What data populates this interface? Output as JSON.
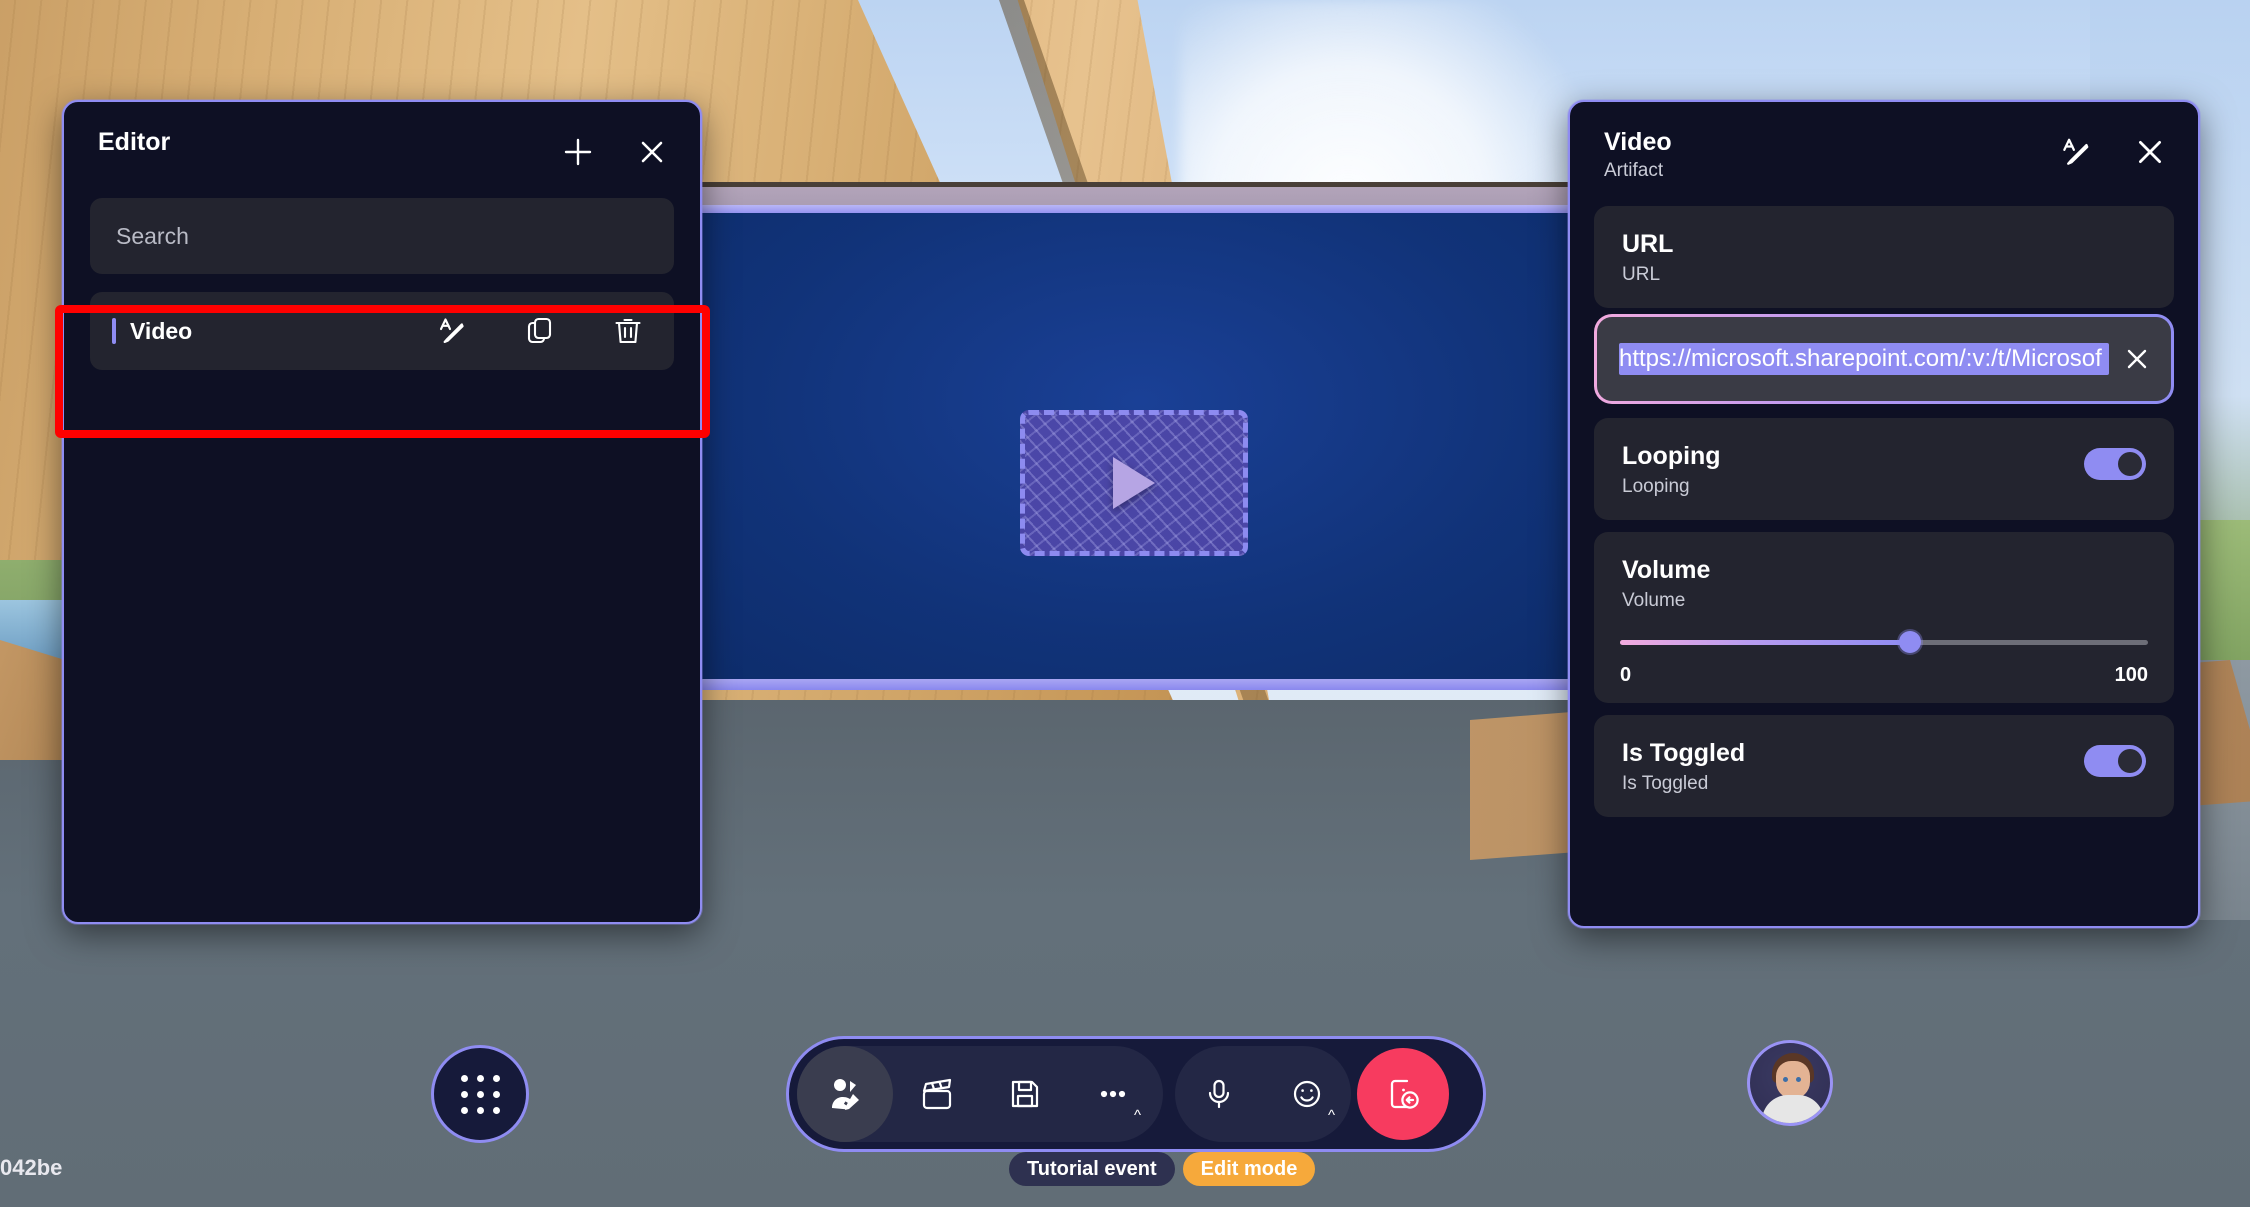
{
  "editor_panel": {
    "title": "Editor",
    "add_icon": "plus-icon",
    "close_icon": "close-icon",
    "search": {
      "placeholder": "Search"
    },
    "items": [
      {
        "label": "Video",
        "rename_icon": "rename-icon",
        "duplicate_icon": "duplicate-icon",
        "delete_icon": "trash-icon"
      }
    ]
  },
  "properties_panel": {
    "title": "Video",
    "subtitle": "Artifact",
    "rename_icon": "rename-icon",
    "close_icon": "close-icon",
    "url_property": {
      "title": "URL",
      "subtitle": "URL",
      "value": "https://microsoft.sharepoint.com/:v:/t/Microsof",
      "selected": true,
      "clear_icon": "close-icon"
    },
    "looping_property": {
      "title": "Looping",
      "subtitle": "Looping",
      "toggle_on": true
    },
    "volume_property": {
      "title": "Volume",
      "subtitle": "Volume",
      "min_label": "0",
      "max_label": "100",
      "value_percent": 55
    },
    "is_toggled_property": {
      "title": "Is Toggled",
      "subtitle": "Is Toggled",
      "toggle_on": true
    }
  },
  "hud": {
    "apps_button_icon": "app-grid-icon",
    "toolbar": [
      {
        "icon": "build-mode-icon",
        "active": true
      },
      {
        "icon": "clapperboard-icon",
        "active": false
      },
      {
        "icon": "save-icon",
        "active": false
      },
      {
        "icon": "more-options-icon",
        "active": false,
        "chevron": "^"
      },
      {
        "icon": "microphone-icon",
        "active": false
      },
      {
        "icon": "emoji-icon",
        "active": false,
        "chevron": "^"
      },
      {
        "icon": "leave-icon",
        "active": false
      }
    ],
    "pills": [
      {
        "label": "Tutorial event",
        "style": "dark"
      },
      {
        "label": "Edit mode",
        "style": "orange"
      }
    ],
    "avatar_name": "user-avatar",
    "session_id": "042be"
  },
  "scene": {
    "video_placeholder_icon": "play-icon"
  },
  "annotation": {
    "highlight_target": "video-list-item",
    "color": "#ff0000"
  },
  "colors": {
    "accent": "#8f8cf2",
    "panel_bg": "#0e1024",
    "card_bg": "#23242f",
    "leave_red": "#f73b5f",
    "edit_mode_orange": "#f6a93b",
    "annotation_red": "#ff0000"
  }
}
